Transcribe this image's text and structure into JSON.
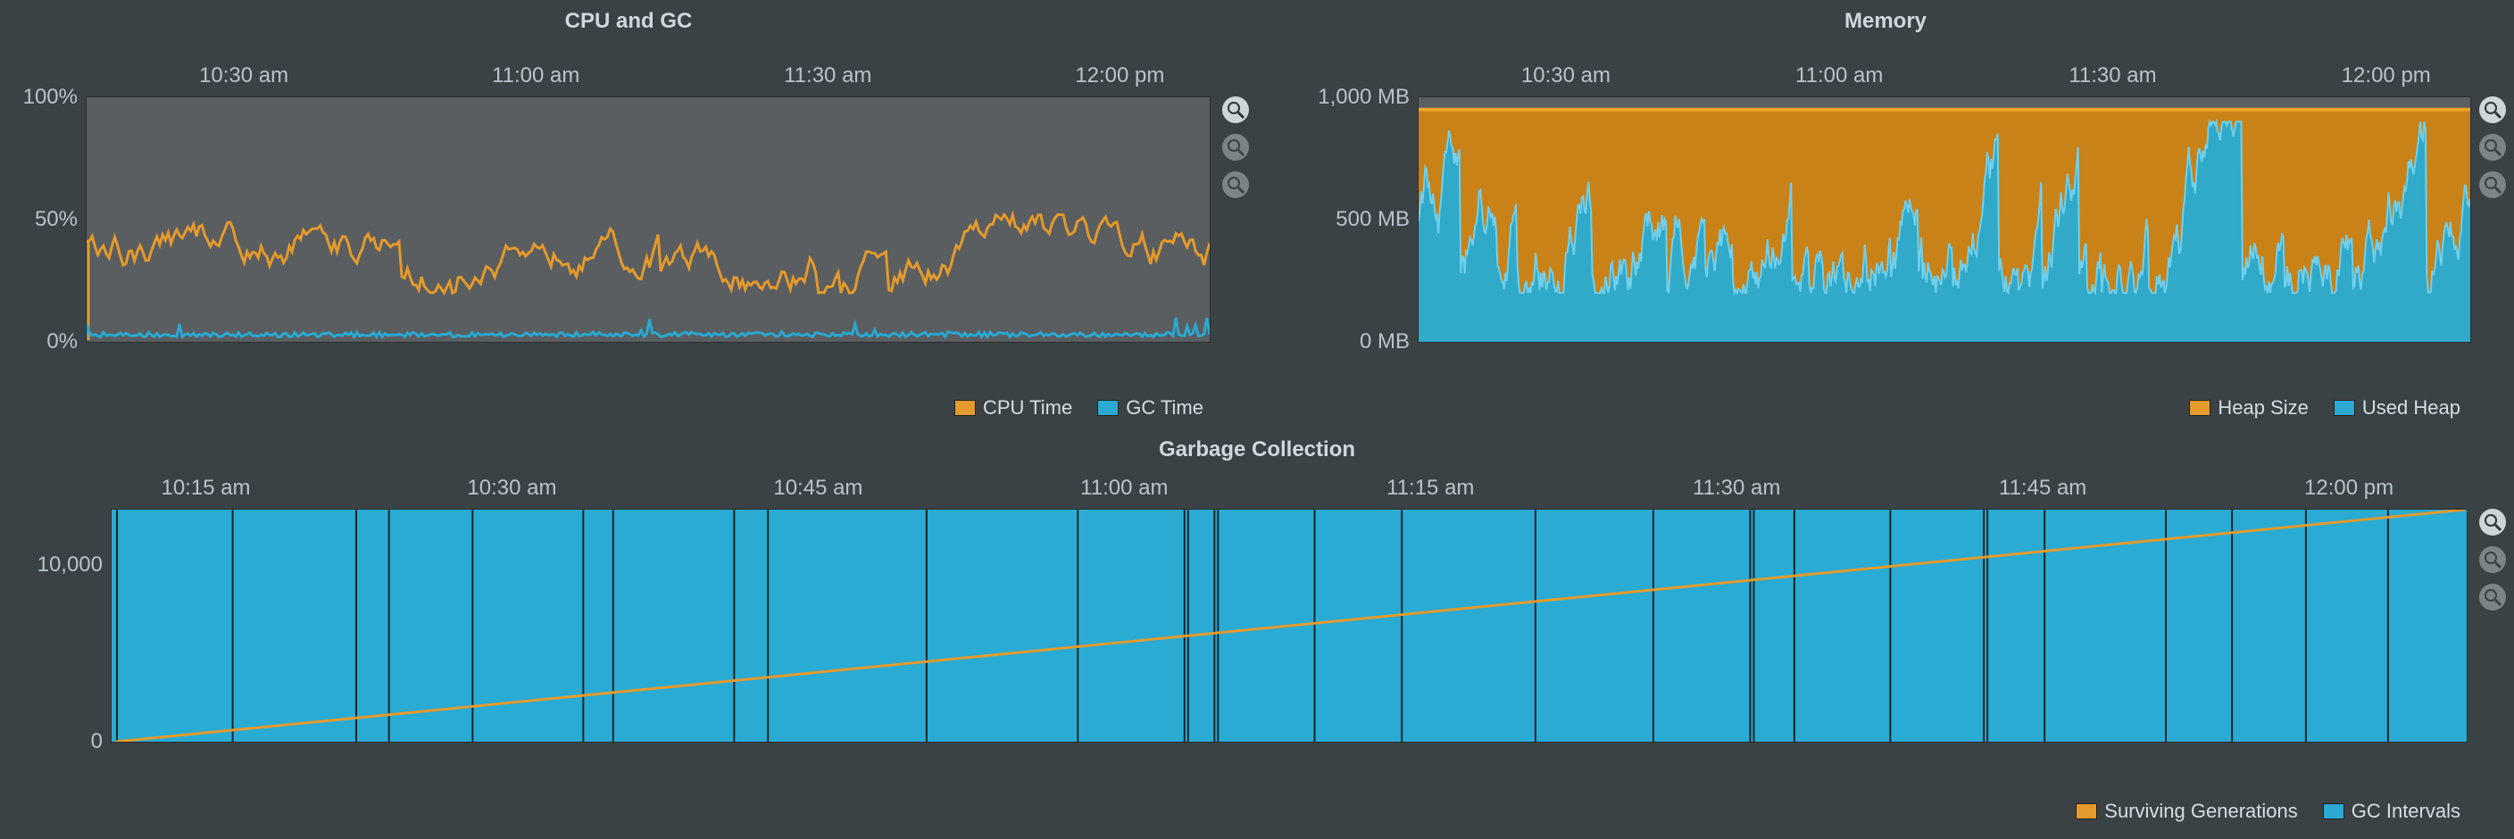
{
  "colors": {
    "orange": "#e59a2c",
    "cyan": "#2aa9d2"
  },
  "cpu_chart": {
    "title": "CPU and GC",
    "x_ticks": [
      "10:30 am",
      "11:00 am",
      "11:30 am",
      "12:00 pm"
    ],
    "y_ticks": [
      "0%",
      "50%",
      "100%"
    ],
    "legend": [
      {
        "label": "CPU Time",
        "color": "orange"
      },
      {
        "label": "GC Time",
        "color": "cyan"
      }
    ]
  },
  "mem_chart": {
    "title": "Memory",
    "x_ticks": [
      "10:30 am",
      "11:00 am",
      "11:30 am",
      "12:00 pm"
    ],
    "y_ticks": [
      "0 MB",
      "500 MB",
      "1,000 MB"
    ],
    "legend": [
      {
        "label": "Heap Size",
        "color": "orange"
      },
      {
        "label": "Used Heap",
        "color": "cyan"
      }
    ]
  },
  "gc_chart": {
    "title": "Garbage Collection",
    "x_ticks": [
      "10:15 am",
      "10:30 am",
      "10:45 am",
      "11:00 am",
      "11:15 am",
      "11:30 am",
      "11:45 am",
      "12:00 pm"
    ],
    "y_ticks": [
      "0",
      "10,000"
    ],
    "legend": [
      {
        "label": "Surviving Generations",
        "color": "orange"
      },
      {
        "label": "GC Intervals",
        "color": "cyan"
      }
    ]
  },
  "chart_data": [
    {
      "id": "cpu",
      "type": "line",
      "title": "CPU and GC",
      "xlabel": "",
      "ylabel": "",
      "x_unit": "time",
      "y_unit": "%",
      "x_range_minutes": [
        610,
        735
      ],
      "ylim": [
        0,
        100
      ],
      "series": [
        {
          "name": "CPU Time",
          "color": "orange",
          "approx_mean": 40,
          "approx_min": 20,
          "approx_max": 52,
          "description": "noisy line fluctuating around 38–45% across the whole window"
        },
        {
          "name": "GC Time",
          "color": "cyan",
          "approx_mean": 2,
          "approx_min": 0,
          "approx_max": 8,
          "description": "mostly near 0%, small spikes up to a few %"
        }
      ]
    },
    {
      "id": "memory",
      "type": "area",
      "title": "Memory",
      "xlabel": "",
      "ylabel": "",
      "x_unit": "time",
      "y_unit": "MB",
      "x_range_minutes": [
        610,
        735
      ],
      "ylim": [
        0,
        1000
      ],
      "series": [
        {
          "name": "Heap Size",
          "color": "orange",
          "approx_const": 950,
          "description": "flat line just below 1,000 MB with orange fill down to Used Heap"
        },
        {
          "name": "Used Heap",
          "color": "cyan",
          "approx_min": 200,
          "approx_max": 900,
          "approx_mean": 550,
          "description": "very jagged sawtooth oscillating roughly 200–900 MB"
        }
      ]
    },
    {
      "id": "gc",
      "type": "line",
      "title": "Garbage Collection",
      "xlabel": "",
      "ylabel": "",
      "x_unit": "time",
      "y_unit": "count",
      "x_range_minutes": [
        610,
        735
      ],
      "ylim": [
        0,
        13000
      ],
      "series": [
        {
          "name": "Surviving Generations",
          "color": "orange",
          "start": 0,
          "end": 13000,
          "description": "straight increasing line from bottom-left to top-right"
        },
        {
          "name": "GC Intervals",
          "color": "cyan",
          "description": "full-height cyan blocks with thin dark gaps marking GC events (dozens of narrow separators)"
        }
      ]
    }
  ]
}
